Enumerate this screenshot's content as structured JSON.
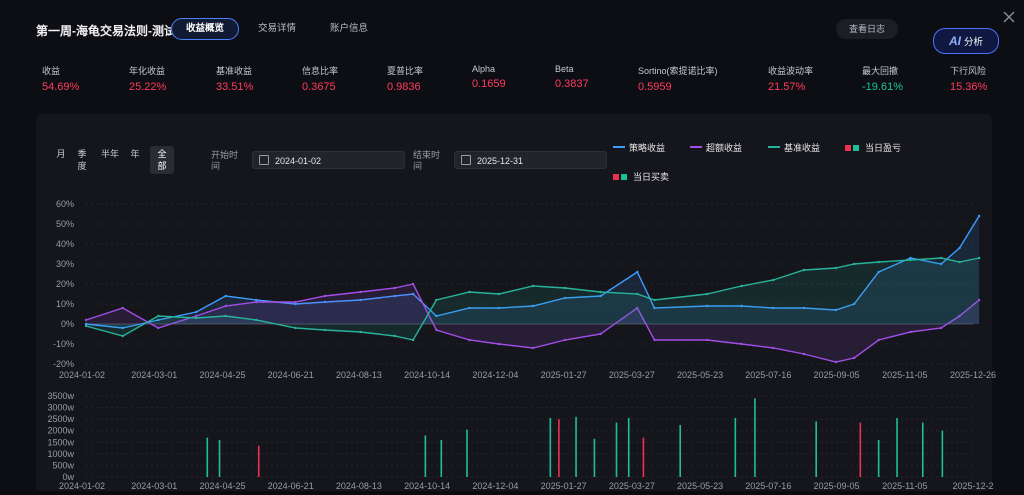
{
  "header": {
    "title": "第一周-海龟交易法则-测试",
    "tabs": [
      {
        "label": "收益概览",
        "active": true
      },
      {
        "label": "交易详情",
        "active": false
      },
      {
        "label": "账户信息",
        "active": false
      }
    ],
    "log_button": "查看日志",
    "ai_button": {
      "badge": "AI",
      "label": "分析"
    }
  },
  "metrics": [
    {
      "label": "收益",
      "value": "54.69%",
      "tone": "pos"
    },
    {
      "label": "年化收益",
      "value": "25.22%",
      "tone": "pos"
    },
    {
      "label": "基准收益",
      "value": "33.51%",
      "tone": "pos"
    },
    {
      "label": "信息比率",
      "value": "0.3675",
      "tone": "pos"
    },
    {
      "label": "夏普比率",
      "value": "0.9836",
      "tone": "pos"
    },
    {
      "label": "Alpha",
      "value": "0.1659",
      "tone": "pos"
    },
    {
      "label": "Beta",
      "value": "0.3837",
      "tone": "pos"
    },
    {
      "label": "Sortino(索提诺比率)",
      "value": "0.5959",
      "tone": "pos"
    },
    {
      "label": "收益波动率",
      "value": "21.57%",
      "tone": "pos"
    },
    {
      "label": "最大回撤",
      "value": "-19.61%",
      "tone": "neg"
    },
    {
      "label": "下行风险",
      "value": "15.36%",
      "tone": "pos"
    }
  ],
  "controls": {
    "periods": [
      {
        "label": "月",
        "active": false
      },
      {
        "label": "季度",
        "active": false
      },
      {
        "label": "半年",
        "active": false
      },
      {
        "label": "年",
        "active": false
      },
      {
        "label": "全部",
        "active": true
      }
    ],
    "start_label": "开始时间",
    "start_value": "2024-01-02",
    "end_label": "结束时间",
    "end_value": "2025-12-31"
  },
  "legend": {
    "strategy": "策略收益",
    "excess": "超额收益",
    "benchmark": "基准收益",
    "daily_pnl": "当日盈亏",
    "daily_trade": "当日买卖"
  },
  "colors": {
    "strategy": "#3d9bff",
    "excess": "#a24ee6",
    "benchmark": "#27b39b",
    "up": "#e8324f",
    "down": "#1fbf95"
  },
  "chart_data": [
    {
      "type": "line",
      "y_ticks": [
        "60%",
        "50%",
        "40%",
        "30%",
        "20%",
        "10%",
        "0%",
        "-10%",
        "-20%"
      ],
      "ylim": [
        -20,
        60
      ],
      "x_ticks": [
        "2024-01-02",
        "2024-03-01",
        "2024-04-25",
        "2024-06-21",
        "2024-08-13",
        "2024-10-14",
        "2024-12-04",
        "2025-01-27",
        "2025-03-27",
        "2025-05-23",
        "2025-07-16",
        "2025-09-05",
        "2025-11-05",
        "2025-12-26"
      ],
      "x": [
        "2024-01-02",
        "2024-02-01",
        "2024-03-01",
        "2024-04-01",
        "2024-04-25",
        "2024-05-20",
        "2024-06-21",
        "2024-07-15",
        "2024-08-13",
        "2024-09-10",
        "2024-09-25",
        "2024-10-14",
        "2024-11-10",
        "2024-12-04",
        "2025-01-01",
        "2025-01-27",
        "2025-02-25",
        "2025-03-27",
        "2025-04-10",
        "2025-05-23",
        "2025-06-20",
        "2025-07-16",
        "2025-08-10",
        "2025-09-05",
        "2025-09-20",
        "2025-10-10",
        "2025-11-05",
        "2025-11-30",
        "2025-12-15",
        "2025-12-31"
      ],
      "series": [
        {
          "name": "策略收益",
          "values": [
            0,
            -2,
            2,
            6,
            14,
            12,
            10,
            11,
            12,
            14,
            15,
            4,
            8,
            8,
            9,
            13,
            14,
            26,
            8,
            9,
            9,
            8,
            8,
            7,
            10,
            26,
            33,
            30,
            38,
            54
          ]
        },
        {
          "name": "超额收益",
          "values": [
            2,
            8,
            -2,
            4,
            9,
            11,
            11,
            14,
            16,
            18,
            20,
            -3,
            -8,
            -10,
            -12,
            -8,
            -5,
            8,
            -8,
            -8,
            -10,
            -12,
            -15,
            -19,
            -17,
            -8,
            -4,
            -2,
            4,
            12
          ]
        },
        {
          "name": "基准收益",
          "values": [
            -1,
            -6,
            4,
            3,
            4,
            2,
            -2,
            -3,
            -4,
            -6,
            -8,
            12,
            16,
            15,
            19,
            18,
            16,
            15,
            12,
            15,
            19,
            22,
            27,
            28,
            30,
            31,
            32,
            33,
            31,
            33
          ]
        }
      ]
    },
    {
      "type": "bar",
      "y_ticks": [
        "3500w",
        "3000w",
        "2500w",
        "2000w",
        "1500w",
        "1000w",
        "500w",
        "0w"
      ],
      "ylim": [
        0,
        3500
      ],
      "x_ticks": [
        "2024-01-02",
        "2024-03-01",
        "2024-04-25",
        "2024-06-21",
        "2024-08-13",
        "2024-10-14",
        "2024-12-04",
        "2025-01-27",
        "2025-03-27",
        "2025-05-23",
        "2025-07-16",
        "2025-09-05",
        "2025-11-05",
        "2025-12-2"
      ],
      "x": [
        "2024-04-10",
        "2024-04-20",
        "2024-05-22",
        "2024-10-05",
        "2024-10-18",
        "2024-11-08",
        "2025-01-15",
        "2025-01-22",
        "2025-02-05",
        "2025-02-20",
        "2025-03-10",
        "2025-03-20",
        "2025-04-01",
        "2025-05-01",
        "2025-06-15",
        "2025-07-01",
        "2025-08-20",
        "2025-09-25",
        "2025-10-10",
        "2025-10-25",
        "2025-11-15",
        "2025-12-01"
      ],
      "series": [
        {
          "name": "当日买卖",
          "values": [
            1700,
            1600,
            1350,
            1800,
            1600,
            2050,
            2550,
            2500,
            2600,
            1650,
            2350,
            2550,
            1700,
            2250,
            2550,
            3400,
            2400,
            2350,
            1600,
            2550,
            2350,
            2000
          ]
        }
      ]
    }
  ]
}
